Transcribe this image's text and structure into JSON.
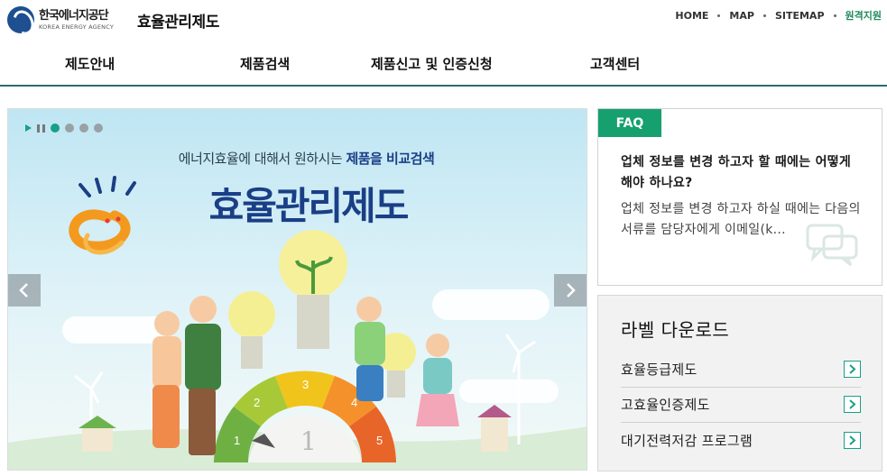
{
  "header": {
    "logo_ko": "한국에너지공단",
    "logo_en": "KOREA ENERGY AGENCY",
    "site_title": "효율관리제도",
    "util_links": [
      "HOME",
      "MAP",
      "SITEMAP",
      "원격지원"
    ]
  },
  "gnb": [
    "제도안내",
    "제품검색",
    "제품신고 및 인증신청",
    "고객센터"
  ],
  "hero": {
    "subtitle_pre": "에너지효율에 대해서 원하시는 ",
    "subtitle_hl": "제품을 비교검색",
    "title": "효율관리제도",
    "slide_count": 4,
    "active_slide": 1,
    "gauge_numbers": [
      "1",
      "2",
      "3",
      "4",
      "5"
    ],
    "gauge_center": "1"
  },
  "faq": {
    "tab": "FAQ",
    "question": "업체 정보를 변경 하고자 할 때에는 어떻게 해야 하나요?",
    "answer": "업체 정보를 변경 하고자 하실 때에는 다음의 서류를 담당자에게 이메일(k..."
  },
  "labels": {
    "title": "라벨 다운로드",
    "items": [
      "효율등급제도",
      "고효율인증제도",
      "대기전력저감 프로그램"
    ]
  },
  "colors": {
    "accent_green": "#16a06f",
    "nav_line": "#2a6d72",
    "hero_navy": "#1a3f86"
  },
  "icons": {
    "hero_prev": "chevron-left-icon",
    "hero_next": "chevron-right-icon",
    "label_link": "chevron-right-icon",
    "faq_deco": "speech-bubbles-icon"
  }
}
